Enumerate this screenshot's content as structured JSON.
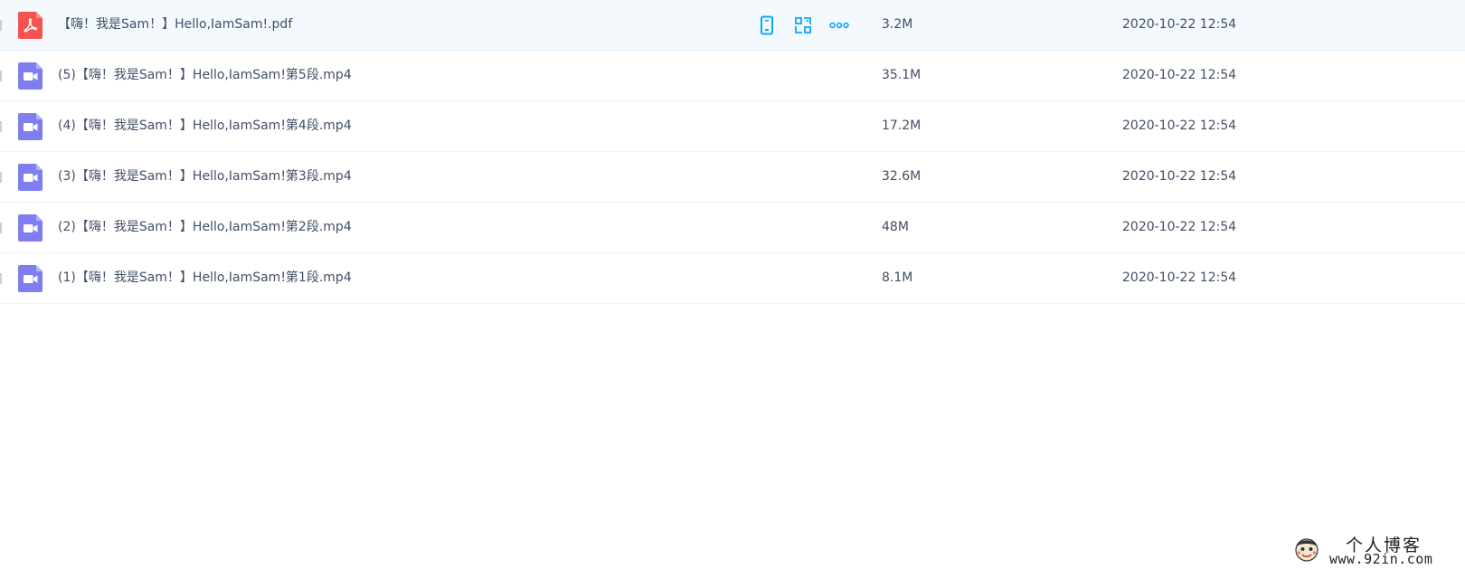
{
  "files": [
    {
      "name": "【嗨！我是Sam！】Hello,IamSam!.pdf",
      "size": "3.2M",
      "date": "2020-10-22 12:54",
      "type_icon": "pdf-icon"
    },
    {
      "name": "(5)【嗨！我是Sam！】Hello,IamSam!第5段.mp4",
      "size": "35.1M",
      "date": "2020-10-22 12:54",
      "type_icon": "video-icon"
    },
    {
      "name": "(4)【嗨！我是Sam！】Hello,IamSam!第4段.mp4",
      "size": "17.2M",
      "date": "2020-10-22 12:54",
      "type_icon": "video-icon"
    },
    {
      "name": "(3)【嗨！我是Sam！】Hello,IamSam!第3段.mp4",
      "size": "32.6M",
      "date": "2020-10-22 12:54",
      "type_icon": "video-icon"
    },
    {
      "name": "(2)【嗨！我是Sam！】Hello,IamSam!第2段.mp4",
      "size": "48M",
      "date": "2020-10-22 12:54",
      "type_icon": "video-icon"
    },
    {
      "name": "(1)【嗨！我是Sam！】Hello,IamSam!第1段.mp4",
      "size": "8.1M",
      "date": "2020-10-22 12:54",
      "type_icon": "video-icon"
    }
  ],
  "row_actions": {
    "icons": [
      "phone-icon",
      "qr-code-icon",
      "more-dots-icon"
    ]
  },
  "watermark": {
    "title": "个人博客",
    "url": "www.92in.com"
  },
  "colors": {
    "pdf": "#f5534f",
    "video": "#7e7ef0",
    "action": "#06a7ff",
    "hover_row": "#f4f9fe",
    "text": "#424e67"
  }
}
